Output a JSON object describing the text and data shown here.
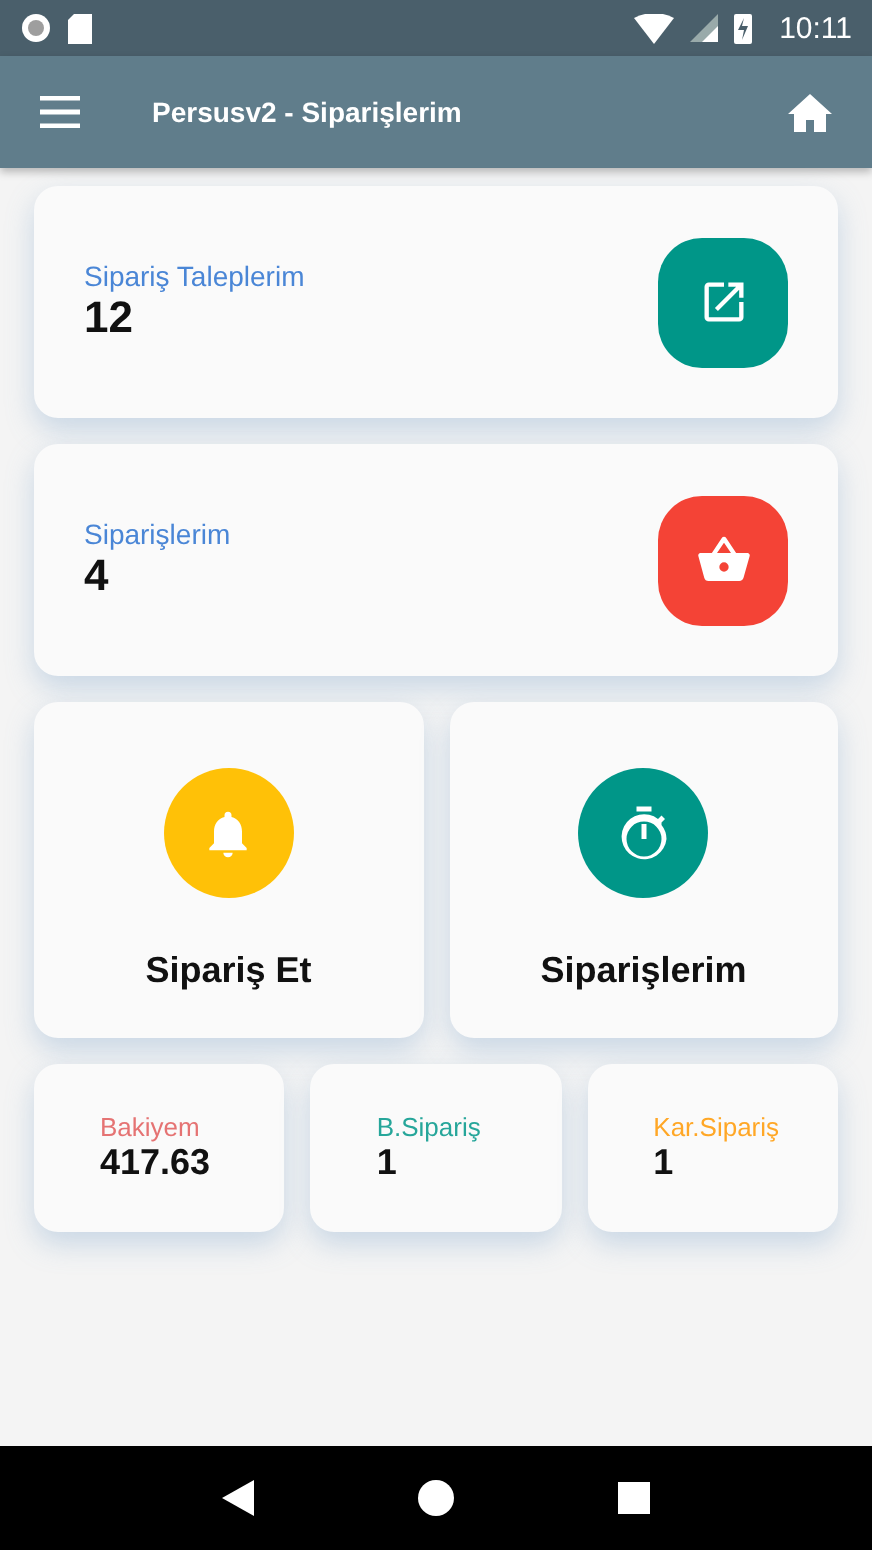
{
  "status_bar": {
    "time": "10:11"
  },
  "app_bar": {
    "title": "Persusv2 - Siparişlerim"
  },
  "summary_cards": [
    {
      "label": "Sipariş Taleplerim",
      "value": "12",
      "kind": "open",
      "color": "#009688"
    },
    {
      "label": "Siparişlerim",
      "value": "4",
      "kind": "basket",
      "color": "#f44336"
    }
  ],
  "tiles": [
    {
      "label": "Sipariş Et",
      "kind": "bell",
      "color": "#ffc107"
    },
    {
      "label": "Siparişlerim",
      "kind": "timer",
      "color": "#009688"
    }
  ],
  "stats": [
    {
      "label": "Bakiyem",
      "value": "417.63",
      "color": "#e57373"
    },
    {
      "label": "B.Sipariş",
      "value": "1",
      "color": "#26a69a"
    },
    {
      "label": "Kar.Sipariş",
      "value": "1",
      "color": "#ffa726"
    }
  ]
}
